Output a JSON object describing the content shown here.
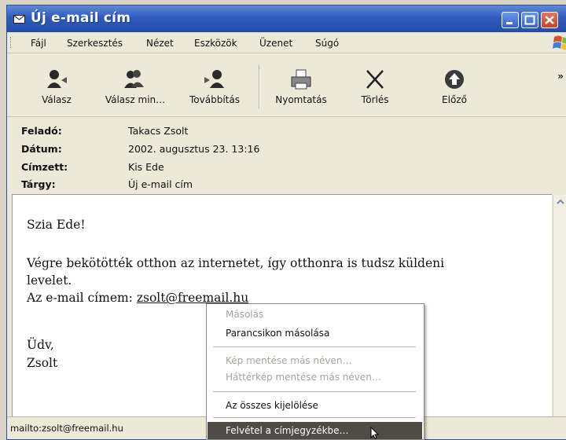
{
  "window": {
    "title": "Új e-mail cím"
  },
  "menu": [
    "Fájl",
    "Szerkesztés",
    "Nézet",
    "Eszközök",
    "Üzenet",
    "Súgó"
  ],
  "toolbar": {
    "buttons": [
      {
        "label": "Válasz",
        "icon": "reply-icon"
      },
      {
        "label": "Válasz min…",
        "icon": "reply-all-icon"
      },
      {
        "label": "Továbbítás",
        "icon": "forward-icon"
      },
      {
        "label": "Nyomtatás",
        "icon": "printer-icon"
      },
      {
        "label": "Törlés",
        "icon": "delete-x-icon"
      },
      {
        "label": "Előző",
        "icon": "previous-arrow-icon"
      }
    ],
    "more": "»"
  },
  "header": {
    "from_label": "Feladó:",
    "from": "Takacs Zsolt",
    "date_label": "Dátum:",
    "date": "2002. augusztus 23. 13:16",
    "to_label": "Címzett:",
    "to": "Kis Ede",
    "subject_label": "Tárgy:",
    "subject": "Új e-mail cím"
  },
  "message": {
    "greeting": "Szia Ede!",
    "line1": "Végre bekötötték otthon az internetet, így otthonra is tudsz küldeni",
    "line2": "levelet.",
    "line3_prefix": "Az e-mail címem: ",
    "email": "zsolt@freemail.hu",
    "closing": "Üdv,",
    "signature": "Zsolt"
  },
  "context_menu": {
    "items": [
      {
        "label": "Másolás",
        "disabled": true
      },
      {
        "label": "Parancsikon másolása",
        "disabled": false
      },
      {
        "label": "Kép mentése más néven…",
        "disabled": true
      },
      {
        "label": "Háttérkép mentése más néven…",
        "disabled": true
      },
      {
        "label": "Az összes kijelölése",
        "disabled": false
      },
      {
        "label": "Felvétel a címjegyzékbe…",
        "disabled": false,
        "highlighted": true
      }
    ]
  },
  "status": {
    "text": "mailto:zsolt@freemail.hu"
  },
  "colors": {
    "titlebar": "#2f5bbf",
    "chrome": "#ece9d8",
    "menu_highlight": "#4f4c48"
  }
}
